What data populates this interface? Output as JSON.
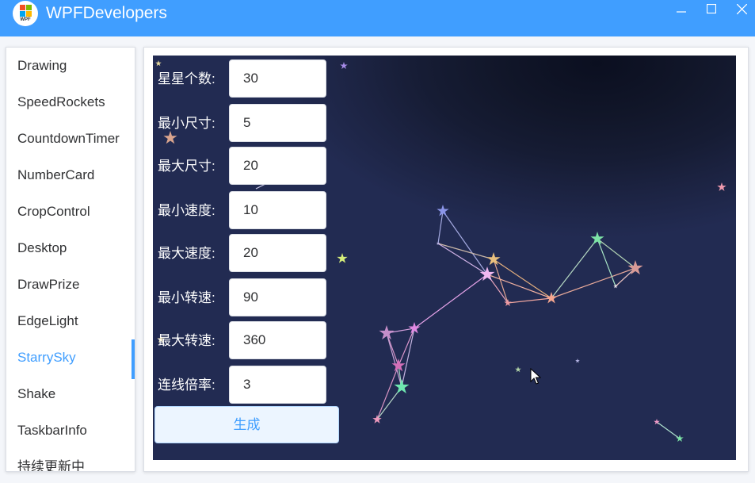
{
  "window": {
    "title": "WPFDevelopers",
    "logo_text": "WPF",
    "accent_color": "#409eff"
  },
  "sidebar": {
    "items": [
      {
        "label": "Drawing"
      },
      {
        "label": "SpeedRockets"
      },
      {
        "label": "CountdownTimer"
      },
      {
        "label": "NumberCard"
      },
      {
        "label": "CropControl"
      },
      {
        "label": "Desktop"
      },
      {
        "label": "DrawPrize"
      },
      {
        "label": "EdgeLight"
      },
      {
        "label": "StarrySky",
        "active": true
      },
      {
        "label": "Shake"
      },
      {
        "label": "TaskbarInfo"
      },
      {
        "label": "持续更新中"
      }
    ]
  },
  "form": {
    "fields": [
      {
        "label": "星星个数:",
        "value": "30"
      },
      {
        "label": "最小尺寸:",
        "value": "5"
      },
      {
        "label": "最大尺寸:",
        "value": "20"
      },
      {
        "label": "最小速度:",
        "value": "10"
      },
      {
        "label": "最大速度:",
        "value": "20"
      },
      {
        "label": "最小转速:",
        "value": "90"
      },
      {
        "label": "最大转速:",
        "value": "360"
      },
      {
        "label": "连线倍率:",
        "value": "3"
      }
    ],
    "generate_label": "生成"
  },
  "icons": {
    "minimize": "minimize-icon",
    "maximize": "maximize-icon",
    "close": "close-icon",
    "star": "star-icon",
    "cursor": "mouse-pointer-icon"
  }
}
